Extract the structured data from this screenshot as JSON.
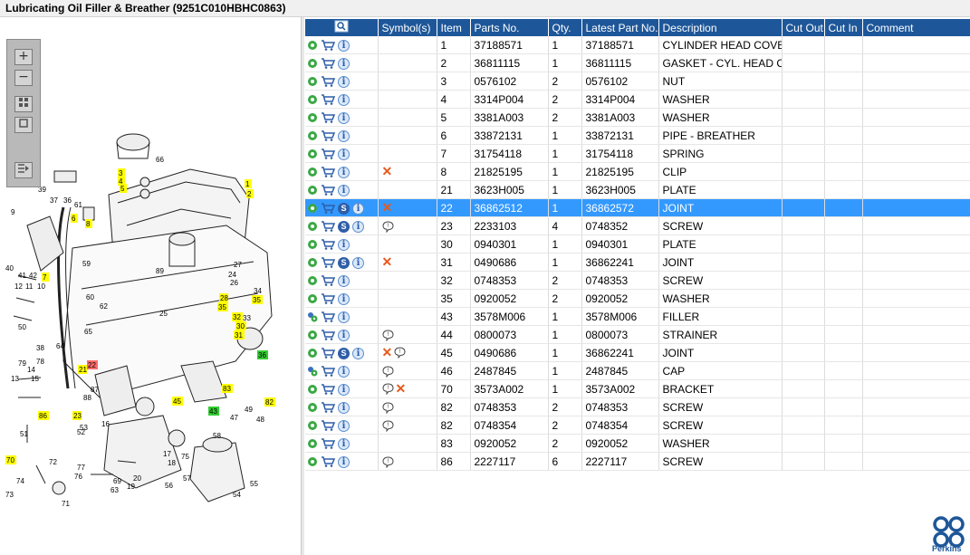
{
  "window": {
    "title": "Lubricating Oil Filler & Breather (9251C010HBHC0863)"
  },
  "toolbar": {
    "zoom_in": "+",
    "zoom_out": "−"
  },
  "table": {
    "headers": [
      "",
      "Symbol(s)",
      "Item",
      "Parts No.",
      "Qty.",
      "Latest Part No.",
      "Description",
      "Cut Out",
      "Cut In",
      "Comment"
    ],
    "rows": [
      {
        "item": "1",
        "part": "37188571",
        "qty": "1",
        "latest": "37188571",
        "desc": "CYLINDER HEAD COVER",
        "s": false,
        "sym": []
      },
      {
        "item": "2",
        "part": "36811115",
        "qty": "1",
        "latest": "36811115",
        "desc": "GASKET - CYL. HEAD COVE",
        "s": false,
        "sym": []
      },
      {
        "item": "3",
        "part": "0576102",
        "qty": "2",
        "latest": "0576102",
        "desc": "NUT",
        "s": false,
        "sym": []
      },
      {
        "item": "4",
        "part": "3314P004",
        "qty": "2",
        "latest": "3314P004",
        "desc": "WASHER",
        "s": false,
        "sym": []
      },
      {
        "item": "5",
        "part": "3381A003",
        "qty": "2",
        "latest": "3381A003",
        "desc": "WASHER",
        "s": false,
        "sym": []
      },
      {
        "item": "6",
        "part": "33872131",
        "qty": "1",
        "latest": "33872131",
        "desc": "PIPE - BREATHER",
        "s": false,
        "sym": []
      },
      {
        "item": "7",
        "part": "31754118",
        "qty": "1",
        "latest": "31754118",
        "desc": "SPRING",
        "s": false,
        "sym": []
      },
      {
        "item": "8",
        "part": "21825195",
        "qty": "1",
        "latest": "21825195",
        "desc": "CLIP",
        "s": false,
        "sym": [
          "x"
        ]
      },
      {
        "item": "21",
        "part": "3623H005",
        "qty": "1",
        "latest": "3623H005",
        "desc": "PLATE",
        "s": false,
        "sym": []
      },
      {
        "item": "22",
        "part": "36862512",
        "qty": "1",
        "latest": "36862572",
        "desc": "JOINT",
        "s": true,
        "sym": [
          "x"
        ],
        "selected": true
      },
      {
        "item": "23",
        "part": "2233103",
        "qty": "4",
        "latest": "0748352",
        "desc": "SCREW",
        "s": true,
        "sym": [
          "b"
        ]
      },
      {
        "item": "30",
        "part": "0940301",
        "qty": "1",
        "latest": "0940301",
        "desc": "PLATE",
        "s": false,
        "sym": []
      },
      {
        "item": "31",
        "part": "0490686",
        "qty": "1",
        "latest": "36862241",
        "desc": "JOINT",
        "s": true,
        "sym": [
          "x"
        ]
      },
      {
        "item": "32",
        "part": "0748353",
        "qty": "2",
        "latest": "0748353",
        "desc": "SCREW",
        "s": false,
        "sym": []
      },
      {
        "item": "35",
        "part": "0920052",
        "qty": "2",
        "latest": "0920052",
        "desc": "WASHER",
        "s": false,
        "sym": []
      },
      {
        "item": "43",
        "part": "3578M006",
        "qty": "1",
        "latest": "3578M006",
        "desc": "FILLER",
        "s": false,
        "sym": [],
        "gearAlt": true
      },
      {
        "item": "44",
        "part": "0800073",
        "qty": "1",
        "latest": "0800073",
        "desc": "STRAINER",
        "s": false,
        "sym": [
          "b"
        ]
      },
      {
        "item": "45",
        "part": "0490686",
        "qty": "1",
        "latest": "36862241",
        "desc": "JOINT",
        "s": true,
        "sym": [
          "x",
          "b"
        ]
      },
      {
        "item": "46",
        "part": "2487845",
        "qty": "1",
        "latest": "2487845",
        "desc": "CAP",
        "s": false,
        "sym": [
          "b"
        ],
        "gearAlt": true
      },
      {
        "item": "70",
        "part": "3573A002",
        "qty": "1",
        "latest": "3573A002",
        "desc": "BRACKET",
        "s": false,
        "sym": [
          "b",
          "x"
        ]
      },
      {
        "item": "82",
        "part": "0748353",
        "qty": "2",
        "latest": "0748353",
        "desc": "SCREW",
        "s": false,
        "sym": [
          "b"
        ]
      },
      {
        "item": "82",
        "part": "0748354",
        "qty": "2",
        "latest": "0748354",
        "desc": "SCREW",
        "s": false,
        "sym": [
          "b"
        ]
      },
      {
        "item": "83",
        "part": "0920052",
        "qty": "2",
        "latest": "0920052",
        "desc": "WASHER",
        "s": false,
        "sym": []
      },
      {
        "item": "86",
        "part": "2227117",
        "qty": "6",
        "latest": "2227117",
        "desc": "SCREW",
        "s": false,
        "sym": [
          "b"
        ]
      }
    ]
  },
  "diagram": {
    "callouts_yellow": [
      "1",
      "2",
      "3",
      "4",
      "5",
      "6",
      "7",
      "8",
      "21",
      "23",
      "30",
      "31",
      "35",
      "44",
      "45",
      "70",
      "82",
      "83",
      "86",
      "28",
      "32"
    ],
    "callouts_red": [
      "22"
    ],
    "callouts_green": [
      "36",
      "43"
    ],
    "callouts_plain": [
      "66",
      "39",
      "37",
      "36",
      "61",
      "9",
      "40",
      "41",
      "42",
      "12",
      "11",
      "10",
      "50",
      "79",
      "78",
      "14",
      "13",
      "15",
      "51",
      "72",
      "73",
      "74",
      "71",
      "69",
      "63",
      "19",
      "20",
      "56",
      "57",
      "55",
      "54",
      "58",
      "47",
      "48",
      "17",
      "18",
      "75",
      "59",
      "60",
      "62",
      "64",
      "65",
      "89",
      "25",
      "26",
      "24",
      "27",
      "33",
      "34",
      "52",
      "53",
      "76",
      "77",
      "87",
      "88",
      "16",
      "38",
      "49"
    ]
  },
  "brand": {
    "name": "Perkins",
    "color": "#1e5799"
  },
  "colors": {
    "header_bg": "#1e5799",
    "selected_row": "#3399ff",
    "callout_yellow": "#ffff00",
    "callout_red": "#ff6b6b",
    "callout_green": "#33cc33"
  }
}
